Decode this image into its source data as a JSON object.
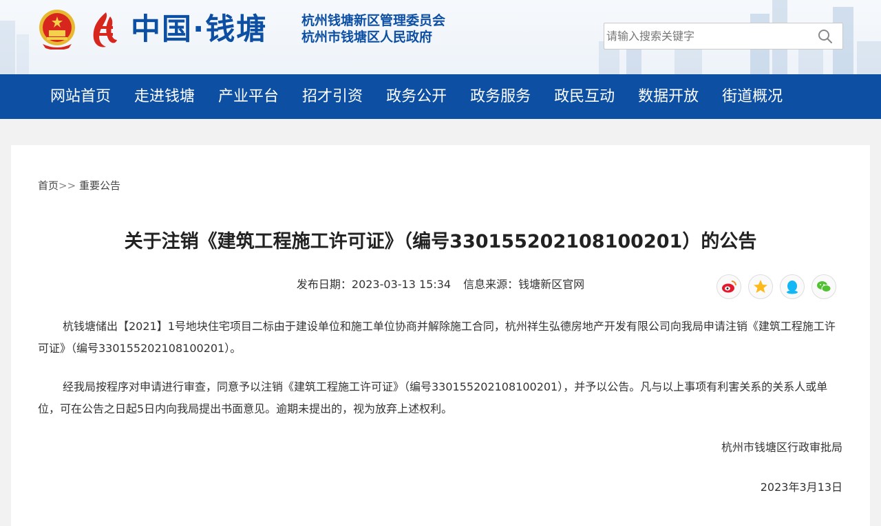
{
  "header": {
    "brand_title": "中国·钱塘",
    "org_name_1": "杭州钱塘新区管理委员会",
    "org_name_2": "杭州市钱塘区人民政府",
    "emblem_icon": "national-emblem-icon",
    "brand_icon": "qiantang-logo-icon",
    "search": {
      "placeholder": "请输入搜索关键字",
      "icon": "search-icon"
    }
  },
  "nav": {
    "items": [
      {
        "label": "网站首页"
      },
      {
        "label": "走进钱塘"
      },
      {
        "label": "产业平台"
      },
      {
        "label": "招才引资"
      },
      {
        "label": "政务公开"
      },
      {
        "label": "政务服务"
      },
      {
        "label": "政民互动"
      },
      {
        "label": "数据开放"
      },
      {
        "label": "街道概况"
      }
    ]
  },
  "breadcrumb": {
    "home": "首页",
    "separator": ">>",
    "current": "重要公告"
  },
  "article": {
    "title": "关于注销《建筑工程施工许可证》（编号330155202108100201）的公告",
    "publish_date": "发布日期：2023-03-13 15:34",
    "source": "信息来源：钱塘新区官网",
    "paragraph_1": "杭钱塘储出【2021】1号地块住宅项目二标由于建设单位和施工单位协商并解除施工合同，杭州祥生弘德房地产开发有限公司向我局申请注销《建筑工程施工许可证》（编号330155202108100201）。",
    "paragraph_2": "经我局按程序对申请进行审查，同意予以注销《建筑工程施工许可证》（编号330155202108100201），并予以公告。凡与以上事项有利害关系的关系人或单位，可在公告之日起5日内向我局提出书面意见。逾期未提出的，视为放弃上述权利。",
    "signature": "杭州市钱塘区行政审批局",
    "date": "2023年3月13日"
  },
  "share": {
    "icons": [
      "weibo-icon",
      "qzone-icon",
      "qq-icon",
      "wechat-icon"
    ]
  },
  "colors": {
    "brand_blue": "#0d4fa3",
    "emblem_red": "#d7261e",
    "emblem_gold": "#e8b830"
  }
}
